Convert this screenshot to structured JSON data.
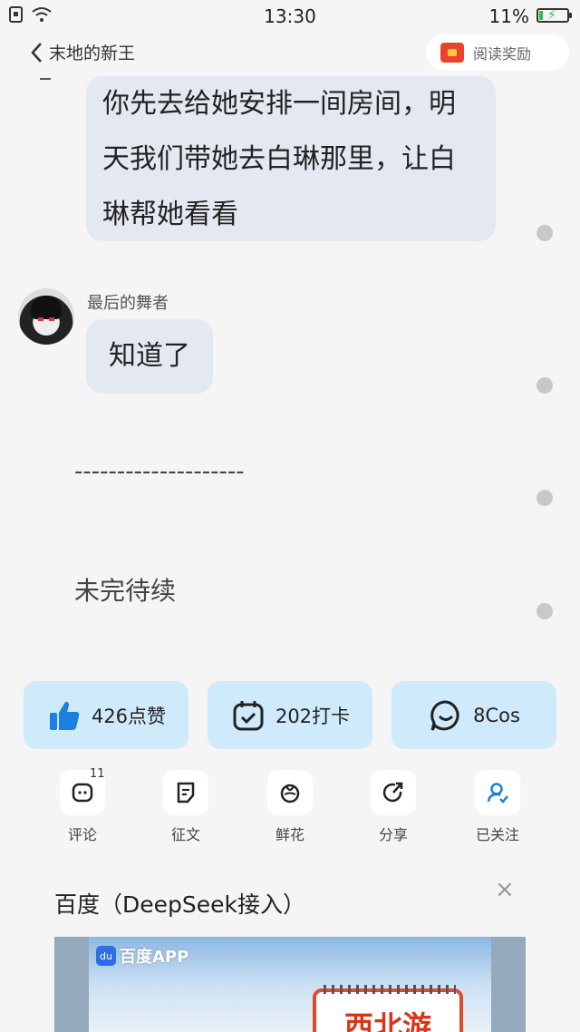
{
  "status_bar": {
    "time": "13:30",
    "battery": "11%"
  },
  "nav": {
    "back_title": "末地的新王",
    "reward_label": "阅读奖励"
  },
  "messages": [
    {
      "text_lines": [
        "你先去给她安排一间房间，明",
        "天我们带她去白琳那里，让白",
        "琳帮她看看"
      ]
    },
    {
      "username": "最后的舞者",
      "text": "知道了"
    }
  ],
  "divider": "--------------------",
  "tbc": "未完待续",
  "actions": [
    {
      "label": "426点赞",
      "icon": "thumbs-up-icon"
    },
    {
      "label": "202打卡",
      "icon": "calendar-check-icon"
    },
    {
      "label": "8Cos",
      "icon": "chat-bubble-icon"
    }
  ],
  "mini_actions": [
    {
      "label": "评论",
      "badge": "11",
      "icon": "comment-icon"
    },
    {
      "label": "征文",
      "icon": "document-icon"
    },
    {
      "label": "鲜花",
      "icon": "flower-icon"
    },
    {
      "label": "分享",
      "icon": "share-icon"
    },
    {
      "label": "已关注",
      "icon": "followed-user-icon"
    }
  ],
  "ad": {
    "title": "百度（DeepSeek接入）",
    "brand": "百度APP",
    "banner_text": "西北游"
  },
  "colors": {
    "accent": "#1a7fe0",
    "action_bg": "#cfeafa",
    "bubble_bg": "#e4e9f1"
  }
}
